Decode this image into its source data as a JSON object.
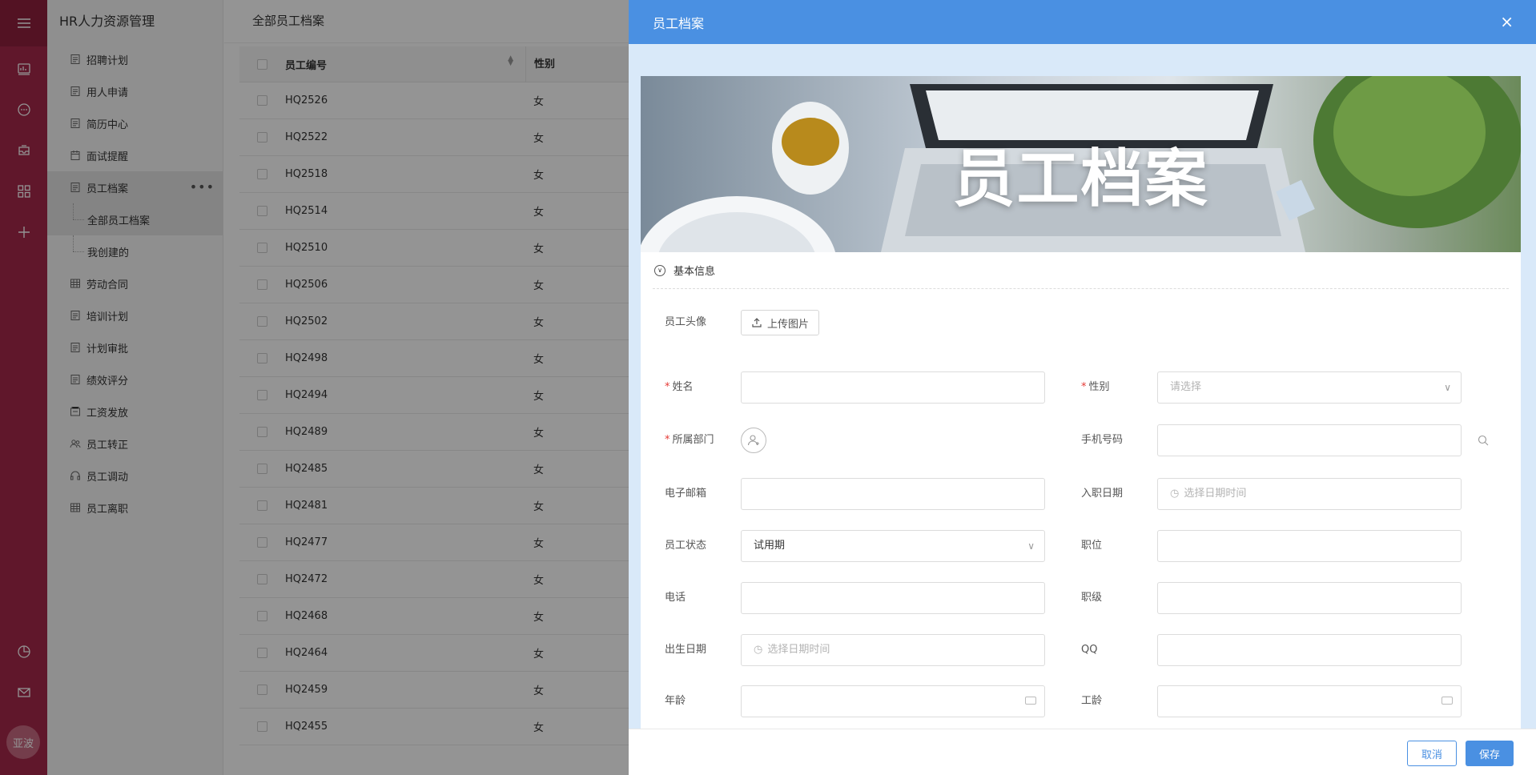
{
  "app": {
    "title": "HR人力资源管理",
    "user": "亚波",
    "colors": {
      "rail": "#a6294b",
      "accent": "#4a90e2"
    }
  },
  "rail": {
    "top_icons": [
      "dashboard-icon",
      "chat-icon",
      "inbox-icon",
      "apps-icon",
      "add-icon"
    ],
    "bottom_icons": [
      "pie-chart-icon",
      "mail-icon"
    ]
  },
  "sidebar": {
    "items": [
      {
        "label": "招聘计划"
      },
      {
        "label": "用人申请"
      },
      {
        "label": "简历中心"
      },
      {
        "label": "面试提醒"
      },
      {
        "label": "员工档案"
      },
      {
        "label": "劳动合同"
      },
      {
        "label": "培训计划"
      },
      {
        "label": "计划审批"
      },
      {
        "label": "绩效评分"
      },
      {
        "label": "工资发放"
      },
      {
        "label": "员工转正"
      },
      {
        "label": "员工调动"
      },
      {
        "label": "员工离职"
      }
    ],
    "sub_items": [
      {
        "label": "全部员工档案"
      },
      {
        "label": "我创建的"
      }
    ],
    "more": "•••"
  },
  "list": {
    "title": "全部员工档案",
    "columns": {
      "no": "员工编号",
      "sex": "性别"
    },
    "rows": [
      {
        "no": "HQ2526",
        "sex": "女"
      },
      {
        "no": "HQ2522",
        "sex": "女"
      },
      {
        "no": "HQ2518",
        "sex": "女"
      },
      {
        "no": "HQ2514",
        "sex": "女"
      },
      {
        "no": "HQ2510",
        "sex": "女"
      },
      {
        "no": "HQ2506",
        "sex": "女"
      },
      {
        "no": "HQ2502",
        "sex": "女"
      },
      {
        "no": "HQ2498",
        "sex": "女"
      },
      {
        "no": "HQ2494",
        "sex": "女"
      },
      {
        "no": "HQ2489",
        "sex": "女"
      },
      {
        "no": "HQ2485",
        "sex": "女"
      },
      {
        "no": "HQ2481",
        "sex": "女"
      },
      {
        "no": "HQ2477",
        "sex": "女"
      },
      {
        "no": "HQ2472",
        "sex": "女"
      },
      {
        "no": "HQ2468",
        "sex": "女"
      },
      {
        "no": "HQ2464",
        "sex": "女"
      },
      {
        "no": "HQ2459",
        "sex": "女"
      },
      {
        "no": "HQ2455",
        "sex": "女"
      }
    ]
  },
  "drawer": {
    "title": "员工档案",
    "close": "×",
    "banner_title": "员工档案",
    "section": "基本信息",
    "fields": {
      "avatar_label": "员工头像",
      "upload_label": "上传图片",
      "name_label": "姓名",
      "sex_label": "性别",
      "sex_placeholder": "请选择",
      "dept_label": "所属部门",
      "phone_label": "手机号码",
      "email_label": "电子邮箱",
      "join_date_label": "入职日期",
      "join_date_placeholder": "选择日期时间",
      "status_label": "员工状态",
      "status_value": "试用期",
      "position_label": "职位",
      "tel_label": "电话",
      "level_label": "职级",
      "birth_label": "出生日期",
      "birth_placeholder": "选择日期时间",
      "qq_label": "QQ",
      "age_label": "年龄",
      "work_age_label": "工龄"
    },
    "footer": {
      "cancel": "取消",
      "save": "保存"
    }
  }
}
